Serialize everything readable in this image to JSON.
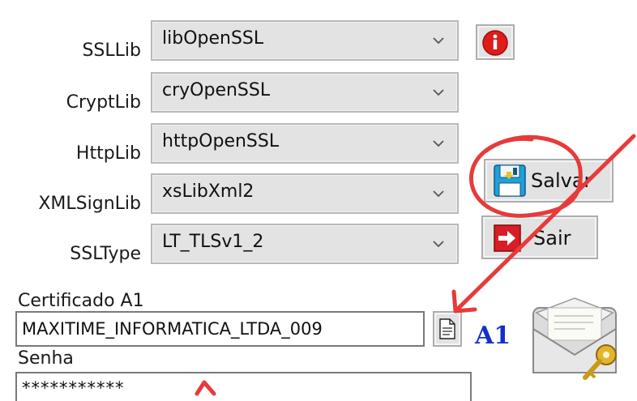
{
  "settings": {
    "ssllib": {
      "label": "SSLLib",
      "value": "libOpenSSL"
    },
    "cryptlib": {
      "label": "CryptLib",
      "value": "cryOpenSSL"
    },
    "httplib": {
      "label": "HttpLib",
      "value": "httpOpenSSL"
    },
    "xmlsignlib": {
      "label": "XMLSignLib",
      "value": "xsLibXml2"
    },
    "ssltype": {
      "label": "SSLType",
      "value": "LT_TLSv1_2"
    }
  },
  "buttons": {
    "salvar": "Salvar",
    "sair": "Sair"
  },
  "certificate": {
    "label": "Certificado A1",
    "value": "MAXITIME_INFORMATICA_LTDA_009",
    "badge": "A1"
  },
  "password": {
    "label": "Senha",
    "value": "***********"
  },
  "colors": {
    "annotation": "#e83a3a",
    "badge": "#1530c8",
    "info": "#e01b1b"
  },
  "icons": {
    "info": "info-icon",
    "save": "floppy-disk-icon",
    "exit": "exit-arrow-icon",
    "file": "document-icon",
    "certificate": "envelope-key-icon"
  }
}
